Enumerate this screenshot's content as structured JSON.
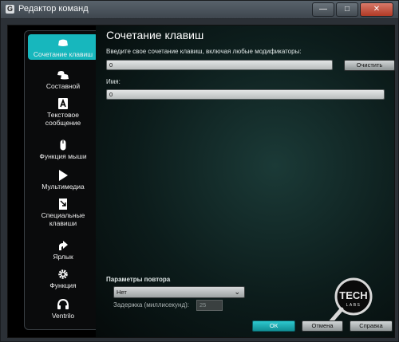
{
  "window": {
    "title": "Редактор команд",
    "buttons": [
      "—",
      "□",
      "✕"
    ]
  },
  "background": {
    "fragments": [
      "C",
      "H",
      "0"
    ]
  },
  "sidebar": {
    "items": [
      {
        "label": "Сочетание клавиш",
        "icon": "keyboard-key-icon",
        "active": true
      },
      {
        "label": "Составной",
        "icon": "multi-key-icon",
        "active": false
      },
      {
        "label": "Текстовое сообщение",
        "icon": "text-a-icon",
        "active": false
      },
      {
        "label": "Функция мыши",
        "icon": "mouse-icon",
        "active": false
      },
      {
        "label": "Мультимедиа",
        "icon": "play-icon",
        "active": false
      },
      {
        "label": "Специальные клавиши",
        "icon": "special-key-icon",
        "active": false
      },
      {
        "label": "Ярлык",
        "icon": "shortcut-arrow-icon",
        "active": false
      },
      {
        "label": "Функция",
        "icon": "gear-icon",
        "active": false
      },
      {
        "label": "Ventrilo",
        "icon": "headset-icon",
        "active": false
      }
    ]
  },
  "main": {
    "heading": "Сочетание клавиш",
    "shortcut_label": "Введите свое сочетание клавиш, включая любые модификаторы:",
    "shortcut_value": "0",
    "clear_button": "Очистить",
    "name_label": "Имя:",
    "name_value": "0",
    "repeat": {
      "label": "Параметры повтора",
      "selected": "Нет",
      "delay_label": "Задержка (миллисекунд):",
      "delay_value": "25"
    },
    "footer": {
      "ok": "ОК",
      "cancel": "Отмена",
      "help": "Справка"
    },
    "logo": {
      "line1": "TECH",
      "line2": "LABS"
    }
  },
  "colors": {
    "accent": "#17b7bd",
    "panel": "#0c1c1b"
  }
}
